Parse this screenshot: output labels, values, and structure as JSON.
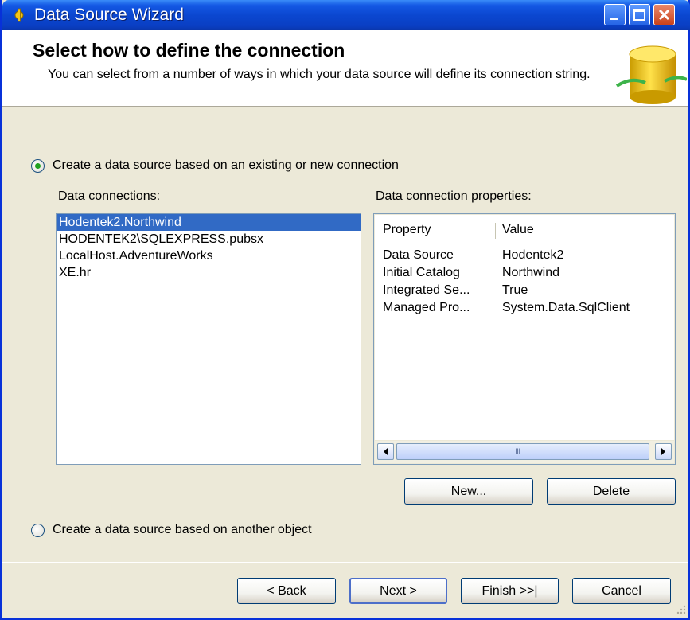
{
  "window": {
    "title": "Data Source Wizard"
  },
  "header": {
    "title": "Select how to define the connection",
    "description": "You can select from a number of ways in which your data source will define its connection string."
  },
  "options": {
    "existing_connection": {
      "label": "Create a data source based on an existing or new connection",
      "checked": true
    },
    "another_object": {
      "label": "Create a data source based on another object",
      "checked": false
    }
  },
  "connections": {
    "label": "Data connections:",
    "items": [
      "Hodentek2.Northwind",
      "HODENTEK2\\SQLEXPRESS.pubsx",
      "LocalHost.AdventureWorks",
      "XE.hr"
    ],
    "selected_index": 0
  },
  "properties": {
    "label": "Data connection properties:",
    "columns": [
      "Property",
      "Value"
    ],
    "rows": [
      [
        "Data Source",
        "Hodentek2"
      ],
      [
        "Initial Catalog",
        "Northwind"
      ],
      [
        "Integrated Se...",
        "True"
      ],
      [
        "Managed Pro...",
        "System.Data.SqlClient"
      ]
    ],
    "scroll_grip": "III"
  },
  "buttons": {
    "new": "New...",
    "delete": "Delete",
    "back": "< Back",
    "next": "Next >",
    "finish": "Finish >>|",
    "cancel": "Cancel"
  },
  "colors": {
    "titlebar": "#0b47d0",
    "selection": "#316ac5",
    "radio_dot": "#21a121",
    "dialog_bg": "#ece9d8"
  }
}
